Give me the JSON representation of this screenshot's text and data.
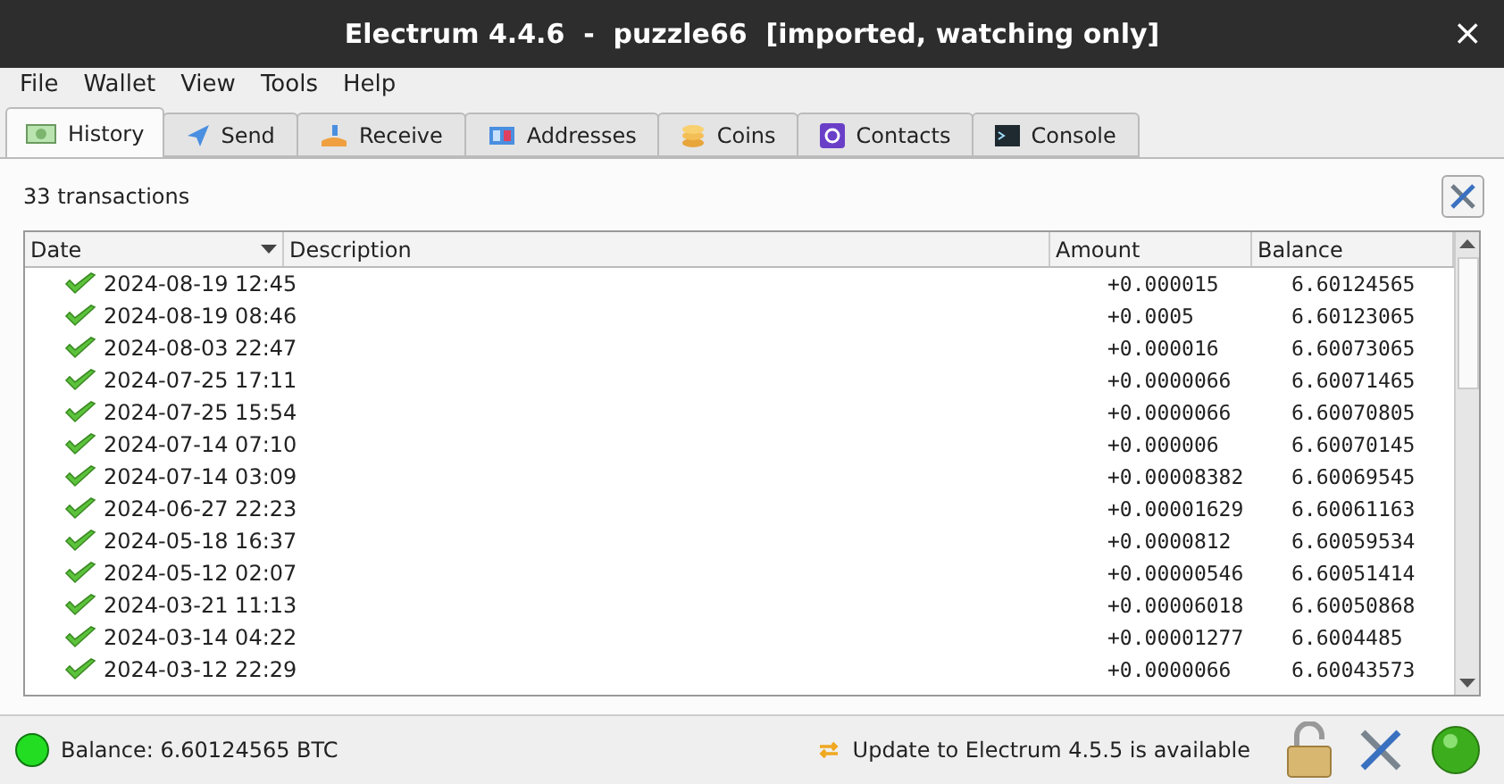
{
  "window": {
    "title": "Electrum 4.4.6  -  puzzle66  [imported, watching only]",
    "close": "×"
  },
  "menu": [
    "File",
    "Wallet",
    "View",
    "Tools",
    "Help"
  ],
  "tabs": [
    {
      "label": "History",
      "selected": true,
      "kind": "history"
    },
    {
      "label": "Send",
      "selected": false,
      "kind": "send"
    },
    {
      "label": "Receive",
      "selected": false,
      "kind": "receive"
    },
    {
      "label": "Addresses",
      "selected": false,
      "kind": "addresses"
    },
    {
      "label": "Coins",
      "selected": false,
      "kind": "coins"
    },
    {
      "label": "Contacts",
      "selected": false,
      "kind": "contacts"
    },
    {
      "label": "Console",
      "selected": false,
      "kind": "console"
    }
  ],
  "summary": "33 transactions",
  "table": {
    "columns": [
      "Date",
      "Description",
      "Amount",
      "Balance"
    ],
    "rows": [
      {
        "date": "2024-08-19 12:45",
        "amount": "+0.000015",
        "balance": "6.60124565"
      },
      {
        "date": "2024-08-19 08:46",
        "amount": "+0.0005",
        "balance": "6.60123065"
      },
      {
        "date": "2024-08-03 22:47",
        "amount": "+0.000016",
        "balance": "6.60073065"
      },
      {
        "date": "2024-07-25 17:11",
        "amount": "+0.0000066",
        "balance": "6.60071465"
      },
      {
        "date": "2024-07-25 15:54",
        "amount": "+0.0000066",
        "balance": "6.60070805"
      },
      {
        "date": "2024-07-14 07:10",
        "amount": "+0.000006",
        "balance": "6.60070145"
      },
      {
        "date": "2024-07-14 03:09",
        "amount": "+0.00008382",
        "balance": "6.60069545"
      },
      {
        "date": "2024-06-27 22:23",
        "amount": "+0.00001629",
        "balance": "6.60061163"
      },
      {
        "date": "2024-05-18 16:37",
        "amount": "+0.0000812",
        "balance": "6.60059534"
      },
      {
        "date": "2024-05-12 02:07",
        "amount": "+0.00000546",
        "balance": "6.60051414"
      },
      {
        "date": "2024-03-21 11:13",
        "amount": "+0.00006018",
        "balance": "6.60050868"
      },
      {
        "date": "2024-03-14 04:22",
        "amount": "+0.00001277",
        "balance": "6.6004485"
      },
      {
        "date": "2024-03-12 22:29",
        "amount": "+0.0000066",
        "balance": "6.60043573"
      }
    ]
  },
  "status_bar": {
    "balance": "Balance: 6.60124565 BTC",
    "update": "Update to Electrum 4.5.5 is available"
  }
}
